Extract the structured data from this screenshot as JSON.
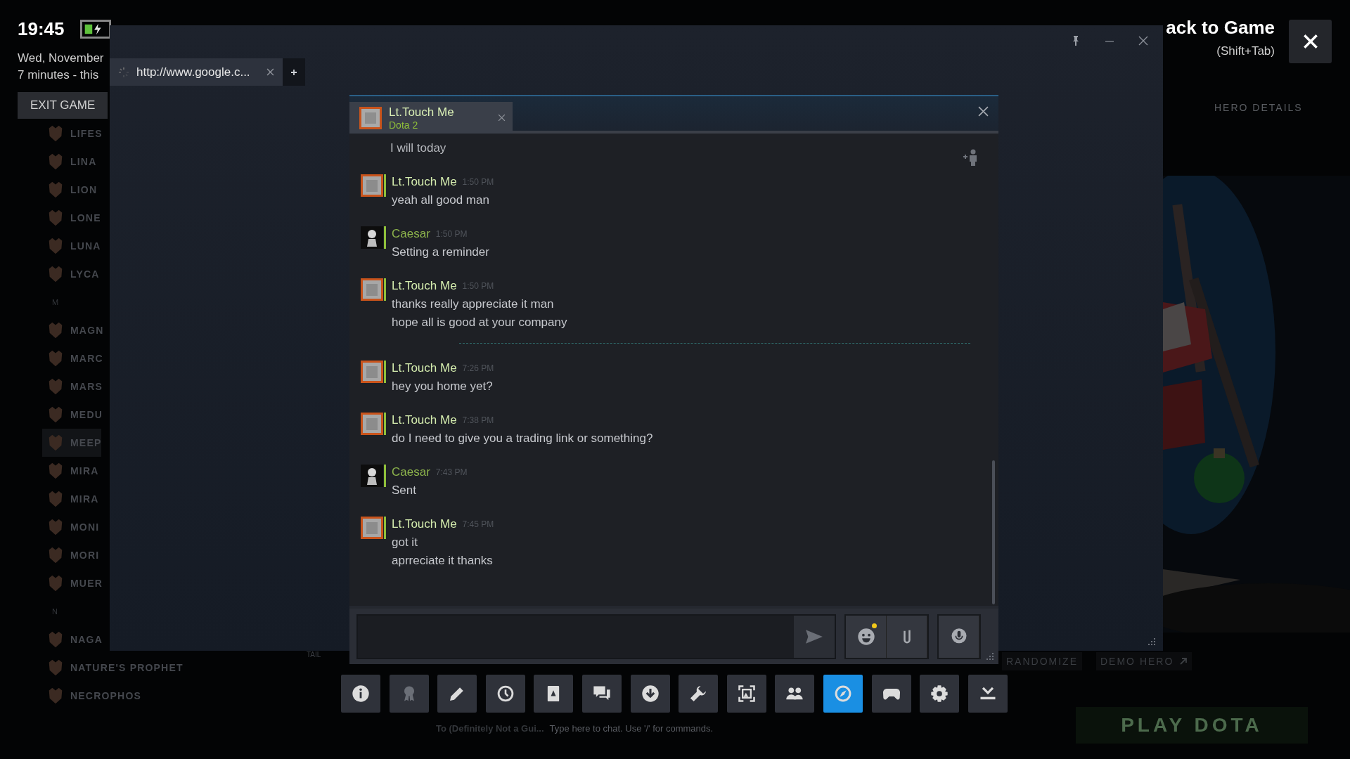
{
  "hud": {
    "time": "19:45",
    "date": "Wed, November",
    "session": "7 minutes - this",
    "exit_button": "EXIT GAME"
  },
  "back_to_game": {
    "title": "ack to Game",
    "shortcut": "(Shift+Tab)"
  },
  "browser": {
    "tabs": [
      {
        "label": "http://www.google.c...",
        "selected": true,
        "loading": true
      }
    ]
  },
  "chat": {
    "tabs": [
      {
        "name": "Lt.Touch Me",
        "game": "Dota 2",
        "selected": true
      }
    ],
    "messages": [
      {
        "kind": "fragment",
        "lines": [
          "I will today"
        ]
      },
      {
        "kind": "message",
        "friend": true,
        "name": "Lt.Touch Me",
        "time": "1:50 PM",
        "lines": [
          "yeah all good man"
        ]
      },
      {
        "kind": "message",
        "friend": false,
        "name": "Caesar",
        "time": "1:50 PM",
        "lines": [
          "Setting a reminder"
        ]
      },
      {
        "kind": "message",
        "friend": true,
        "name": "Lt.Touch Me",
        "time": "1:50 PM",
        "lines": [
          "thanks really appreciate it man",
          "hope all is good at your company"
        ]
      },
      {
        "kind": "divider"
      },
      {
        "kind": "message",
        "friend": true,
        "name": "Lt.Touch Me",
        "time": "7:26 PM",
        "lines": [
          "hey you home yet?"
        ]
      },
      {
        "kind": "message",
        "friend": true,
        "name": "Lt.Touch Me",
        "time": "7:38 PM",
        "lines": [
          "do I need to give you a trading link or something?"
        ]
      },
      {
        "kind": "message",
        "friend": false,
        "name": "Caesar",
        "time": "7:43 PM",
        "lines": [
          "Sent"
        ]
      },
      {
        "kind": "message",
        "friend": true,
        "name": "Lt.Touch Me",
        "time": "7:45 PM",
        "lines": [
          "got it",
          "aprreciate it thanks"
        ]
      }
    ],
    "emoji_notice": true
  },
  "toolbar": [
    {
      "selected": false
    },
    {
      "selected": false
    },
    {
      "selected": false
    },
    {
      "selected": false
    },
    {
      "selected": false
    },
    {
      "selected": false
    },
    {
      "selected": false
    },
    {
      "selected": false
    },
    {
      "selected": false
    },
    {
      "selected": false
    },
    {
      "selected": true
    },
    {
      "selected": false
    },
    {
      "selected": false
    },
    {
      "selected": false
    }
  ],
  "game": {
    "heroes": [
      {
        "kind": "hero",
        "name": "LIFES",
        "selected": false
      },
      {
        "kind": "hero",
        "name": "LINA",
        "selected": false
      },
      {
        "kind": "hero",
        "name": "LION",
        "selected": false
      },
      {
        "kind": "hero",
        "name": "LONE",
        "selected": false
      },
      {
        "kind": "hero",
        "name": "LUNA",
        "selected": false
      },
      {
        "kind": "hero",
        "name": "LYCA",
        "selected": false
      },
      {
        "kind": "letter",
        "name": "M"
      },
      {
        "kind": "hero",
        "name": "MAGN",
        "selected": false
      },
      {
        "kind": "hero",
        "name": "MARC",
        "selected": false
      },
      {
        "kind": "hero",
        "name": "MARS",
        "selected": false
      },
      {
        "kind": "hero",
        "name": "MEDU",
        "selected": false
      },
      {
        "kind": "hero",
        "name": "MEEP",
        "selected": true
      },
      {
        "kind": "hero",
        "name": "MIRA",
        "selected": false
      },
      {
        "kind": "hero",
        "name": "MIRA",
        "selected": false
      },
      {
        "kind": "hero",
        "name": "MONI",
        "selected": false
      },
      {
        "kind": "hero",
        "name": "MORI",
        "selected": false
      },
      {
        "kind": "hero",
        "name": "MUER",
        "selected": false
      },
      {
        "kind": "letter",
        "name": "N"
      },
      {
        "kind": "hero",
        "name": "NAGA",
        "selected": false
      },
      {
        "kind": "hero",
        "name": "NATURE'S PROPHET",
        "selected": false
      },
      {
        "kind": "hero",
        "name": "NECROPHOS",
        "selected": false
      }
    ],
    "tail": "TAIL",
    "hero_details": "HERO DETAILS",
    "randomize": "RANDOMIZE",
    "demo_hero": "DEMO HERO",
    "play": "PLAY DOTA",
    "chat_to": "To (Definitely Not a Gui...",
    "chat_hint": "Type here to chat. Use '/' for commands."
  }
}
